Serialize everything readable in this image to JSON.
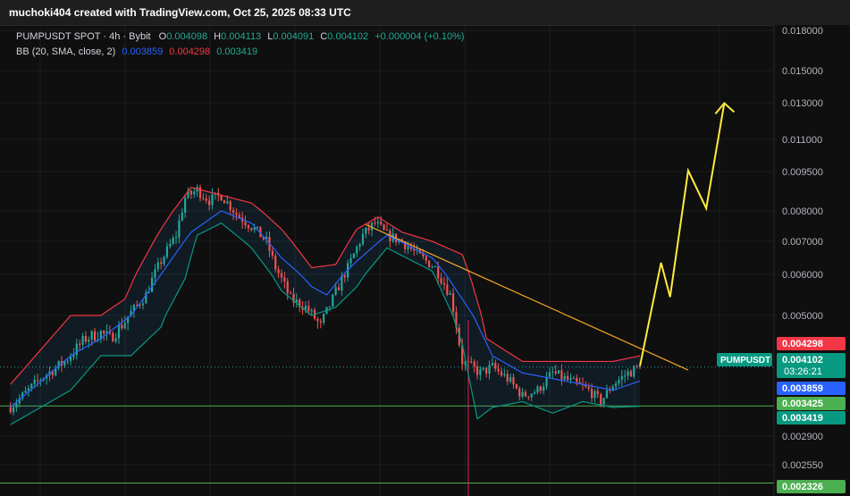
{
  "header": {
    "credit": "muchoki404 created with TradingView.com, Oct 25, 2025 08:33 UTC"
  },
  "legend": {
    "symbol": "PUMPUSDT SPOT · 4h · Bybit",
    "o_label": "O",
    "o_value": "0.004098",
    "h_label": "H",
    "h_value": "0.004113",
    "l_label": "L",
    "l_value": "0.004091",
    "c_label": "C",
    "c_value": "0.004102",
    "change": "+0.000004 (+0.10%)",
    "bb_label": "BB (20, SMA, close, 2)",
    "bb_basis": "0.003859",
    "bb_upper": "0.004298",
    "bb_lower": "0.003419"
  },
  "colors": {
    "background": "#0f0f0f",
    "grid": "#1e1e1e",
    "up": "#26a69a",
    "down": "#ef5350",
    "bb_basis": "#2962ff",
    "bb_upper": "#f23645",
    "bb_lower": "#089981",
    "trendline": "#f5a623",
    "projection": "#ffeb3b",
    "hline": "#4caf50",
    "vline": "#e91e63"
  },
  "chart_data": {
    "type": "candlestick",
    "y_axis": {
      "ticks": [
        "0.018000",
        "0.015000",
        "0.013000",
        "0.011000",
        "0.009500",
        "0.008000",
        "0.007000",
        "0.006000",
        "0.005000",
        "0.002900",
        "0.002550"
      ],
      "tick_values": [
        0.018,
        0.015,
        0.013,
        0.011,
        0.0095,
        0.008,
        0.007,
        0.006,
        0.005,
        0.0029,
        0.00255
      ]
    },
    "price_labels": [
      {
        "text": "0.004298",
        "value": 0.004298,
        "color": "#f23645"
      },
      {
        "text": "0.004102",
        "value": 0.004102,
        "color": "#089981",
        "symbol": "PUMPUSDT",
        "countdown": "03:26:21"
      },
      {
        "text": "0.003859",
        "value": 0.003859,
        "color": "#2962ff"
      },
      {
        "text": "0.003425",
        "value": 0.003425,
        "color": "#4caf50"
      },
      {
        "text": "0.003419",
        "value": 0.003419,
        "color": "#089981"
      },
      {
        "text": "0.002326",
        "value": 0.002326,
        "color": "#4caf50"
      }
    ],
    "horizontal_lines": [
      0.003425,
      0.002326
    ],
    "last_price": 0.004102,
    "n_bars": 210,
    "anchors": [
      [
        0,
        0.0034
      ],
      [
        10,
        0.0039
      ],
      [
        18,
        0.0042
      ],
      [
        25,
        0.0046
      ],
      [
        30,
        0.0047
      ],
      [
        33,
        0.0046
      ],
      [
        38,
        0.0049
      ],
      [
        45,
        0.0055
      ],
      [
        50,
        0.0064
      ],
      [
        55,
        0.0072
      ],
      [
        58,
        0.0085
      ],
      [
        62,
        0.0088
      ],
      [
        66,
        0.0084
      ],
      [
        70,
        0.0086
      ],
      [
        75,
        0.0079
      ],
      [
        80,
        0.0075
      ],
      [
        85,
        0.007
      ],
      [
        88,
        0.0062
      ],
      [
        93,
        0.0054
      ],
      [
        98,
        0.0052
      ],
      [
        103,
        0.0048
      ],
      [
        107,
        0.0054
      ],
      [
        112,
        0.0062
      ],
      [
        117,
        0.0072
      ],
      [
        121,
        0.0076
      ],
      [
        125,
        0.0072
      ],
      [
        130,
        0.007
      ],
      [
        135,
        0.0066
      ],
      [
        141,
        0.0062
      ],
      [
        146,
        0.0055
      ],
      [
        150,
        0.0042
      ],
      [
        156,
        0.004
      ],
      [
        160,
        0.0041
      ],
      [
        165,
        0.0039
      ],
      [
        170,
        0.0036
      ],
      [
        175,
        0.0037
      ],
      [
        180,
        0.004
      ],
      [
        184,
        0.0039
      ],
      [
        188,
        0.0038
      ],
      [
        192,
        0.0037
      ],
      [
        196,
        0.0035
      ],
      [
        200,
        0.0038
      ],
      [
        205,
        0.004
      ],
      [
        209,
        0.0041
      ]
    ],
    "bb": {
      "basis": [
        [
          0,
          0.0034
        ],
        [
          20,
          0.0043
        ],
        [
          30,
          0.0046
        ],
        [
          40,
          0.005
        ],
        [
          50,
          0.006
        ],
        [
          60,
          0.0073
        ],
        [
          70,
          0.008
        ],
        [
          80,
          0.0076
        ],
        [
          90,
          0.0065
        ],
        [
          100,
          0.0057
        ],
        [
          105,
          0.0055
        ],
        [
          115,
          0.0064
        ],
        [
          125,
          0.0072
        ],
        [
          140,
          0.0065
        ],
        [
          150,
          0.0054
        ],
        [
          160,
          0.0043
        ],
        [
          170,
          0.004
        ],
        [
          180,
          0.0039
        ],
        [
          190,
          0.0038
        ],
        [
          200,
          0.0037
        ],
        [
          209,
          0.003859
        ]
      ],
      "upper": [
        [
          0,
          0.0038
        ],
        [
          20,
          0.005
        ],
        [
          30,
          0.005
        ],
        [
          38,
          0.0054
        ],
        [
          50,
          0.0074
        ],
        [
          60,
          0.0089
        ],
        [
          70,
          0.0086
        ],
        [
          80,
          0.0083
        ],
        [
          90,
          0.0074
        ],
        [
          100,
          0.0062
        ],
        [
          108,
          0.0063
        ],
        [
          115,
          0.0074
        ],
        [
          122,
          0.0078
        ],
        [
          130,
          0.0073
        ],
        [
          140,
          0.007
        ],
        [
          150,
          0.0066
        ],
        [
          158,
          0.0046
        ],
        [
          170,
          0.0042
        ],
        [
          180,
          0.0042
        ],
        [
          190,
          0.0042
        ],
        [
          200,
          0.0042
        ],
        [
          209,
          0.004298
        ]
      ],
      "lower": [
        [
          0,
          0.0031
        ],
        [
          20,
          0.0037
        ],
        [
          30,
          0.0043
        ],
        [
          40,
          0.0043
        ],
        [
          50,
          0.0048
        ],
        [
          58,
          0.0059
        ],
        [
          62,
          0.0072
        ],
        [
          70,
          0.0076
        ],
        [
          80,
          0.0068
        ],
        [
          90,
          0.0056
        ],
        [
          100,
          0.005
        ],
        [
          108,
          0.0052
        ],
        [
          115,
          0.0057
        ],
        [
          125,
          0.0068
        ],
        [
          140,
          0.0061
        ],
        [
          150,
          0.0045
        ],
        [
          155,
          0.0032
        ],
        [
          160,
          0.0034
        ],
        [
          170,
          0.0035
        ],
        [
          180,
          0.0033
        ],
        [
          190,
          0.0035
        ],
        [
          200,
          0.0034
        ],
        [
          209,
          0.003419
        ]
      ]
    },
    "trendline": [
      [
        118,
        0.00755
      ],
      [
        225,
        0.00405
      ]
    ],
    "projection": [
      [
        209,
        0.00412
      ],
      [
        216,
        0.00635
      ],
      [
        219,
        0.00545
      ],
      [
        225,
        0.00955
      ],
      [
        231,
        0.0081
      ],
      [
        237,
        0.01298
      ]
    ],
    "projection_arrow_tip": [
      237,
      0.01298
    ],
    "vline_bar": 152
  }
}
